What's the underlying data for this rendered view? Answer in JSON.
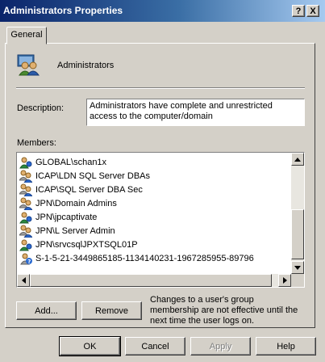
{
  "window": {
    "title": "Administrators Properties"
  },
  "title_buttons": {
    "help": "?",
    "close": "X"
  },
  "tabs": [
    {
      "label": "General"
    }
  ],
  "group": {
    "name": "Administrators",
    "icon": "group-icon"
  },
  "description": {
    "label": "Description:",
    "value": "Administrators have complete and unrestricted access to the computer/domain"
  },
  "members": {
    "label": "Members:",
    "items": [
      {
        "name": "GLOBAL\\schan1x",
        "icon": "user-icon"
      },
      {
        "name": "ICAP\\LDN SQL Server DBAs",
        "icon": "group-icon"
      },
      {
        "name": "ICAP\\SQL Server DBA Sec",
        "icon": "group-icon"
      },
      {
        "name": "JPN\\Domain Admins",
        "icon": "group-icon"
      },
      {
        "name": "JPN\\jpcaptivate",
        "icon": "user-icon"
      },
      {
        "name": "JPN\\L Server Admin",
        "icon": "group-icon"
      },
      {
        "name": "JPN\\srvcsqlJPXTSQL01P",
        "icon": "user-icon"
      },
      {
        "name": "S-1-5-21-3449865185-1134140231-1967285955-89796",
        "icon": "unknown-sid-icon"
      }
    ]
  },
  "buttons": {
    "add": "Add...",
    "remove": "Remove",
    "ok": "OK",
    "cancel": "Cancel",
    "apply": "Apply",
    "help": "Help"
  },
  "note": "Changes to a user's group membership are not effective until the next time the user logs on.",
  "colors": {
    "titlebar_start": "#0a246a",
    "titlebar_end": "#a6caf0",
    "face": "#d4d0c8"
  }
}
